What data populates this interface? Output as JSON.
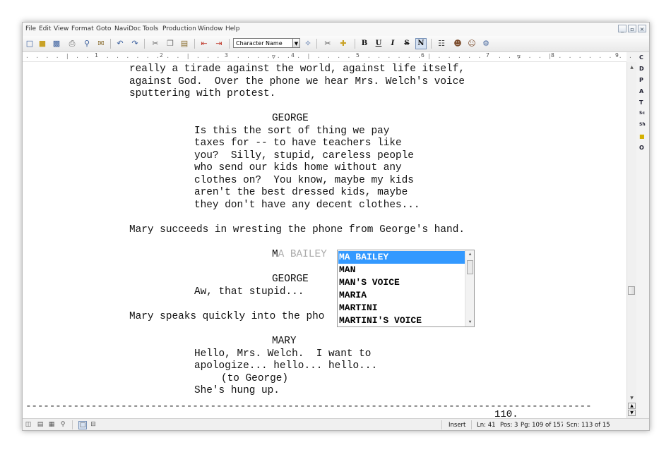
{
  "menu": [
    "File",
    "Edit",
    "View",
    "Format",
    "Goto",
    "NaviDoc",
    "Tools",
    "Production",
    "Window",
    "Help"
  ],
  "window_controls": [
    "_",
    "▫",
    "×"
  ],
  "toolbar": {
    "element_style": "Character Name",
    "format_buttons": [
      "B",
      "U",
      "I",
      "S",
      "N"
    ],
    "active_format": "N"
  },
  "ruler": {
    "numbers": [
      "1",
      "2",
      "3",
      "4",
      "5",
      "6",
      "7",
      "8",
      "9"
    ]
  },
  "palette": [
    "C",
    "D",
    "P",
    "A",
    "T",
    "Sc",
    "Sh",
    "O"
  ],
  "script": {
    "action_1": "really a tirade against the world, against life itself,",
    "action_2": "against God.  Over the phone we hear Mrs. Welch's voice",
    "action_3": "sputtering with protest.",
    "char_1": "GEORGE",
    "dialogue_1": [
      "Is this the sort of thing we pay",
      "taxes for -- to have teachers like",
      "you?  Silly, stupid, careless people",
      "who send our kids home without any",
      "clothes on?  You know, maybe my kids",
      "aren't the best dressed kids, maybe",
      "they don't have any decent clothes..."
    ],
    "action_4": "Mary succeeds in wresting the phone from George's hand.",
    "typed": "M",
    "ghost": "A BAILEY",
    "char_2": "GEORGE",
    "dialogue_2": "Aw, that stupid...",
    "action_5": "Mary speaks quickly into the pho",
    "char_3": "MARY",
    "dialogue_3": [
      "Hello, Mrs. Welch.  I want to",
      "apologize... hello... hello..."
    ],
    "paren_1": "(to George)",
    "dialogue_4": "She's hung up.",
    "page_break": "-----------------------------------------------------------------------------------------------",
    "page_number": "110."
  },
  "autocomplete": {
    "options": [
      "MA BAILEY",
      "MAN",
      "MAN'S VOICE",
      "MARIA",
      "MARTINI",
      "MARTINI'S VOICE"
    ],
    "selected_index": 0
  },
  "status": {
    "mode": "Insert",
    "line": "Ln: 41",
    "pos": "Pos: 3",
    "page": "Pg: 109 of 157",
    "scene": "Scn: 113  of 15"
  }
}
